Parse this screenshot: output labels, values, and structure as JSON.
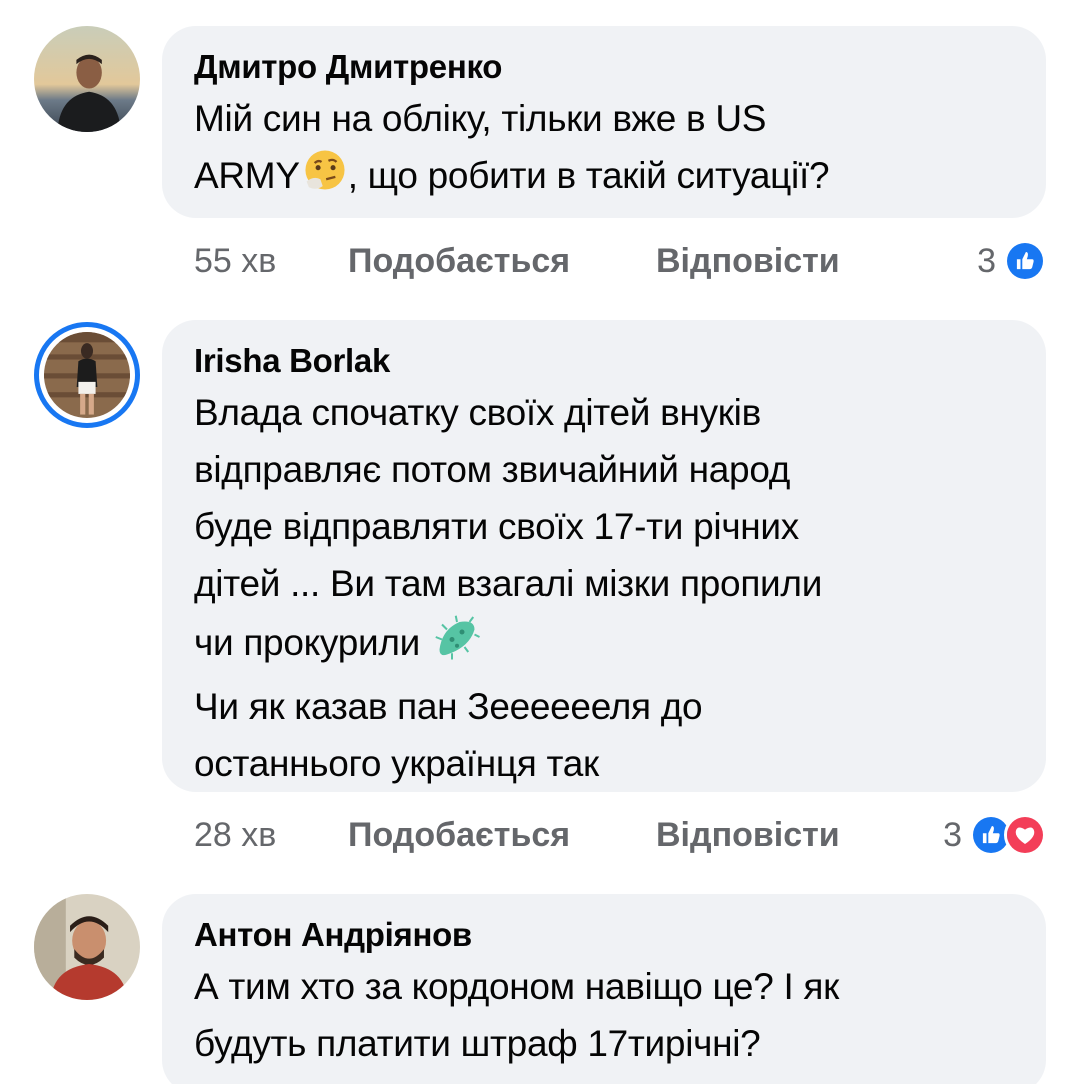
{
  "comments": [
    {
      "author": "Дмитро Дмитренко",
      "lines": [
        "Мій син на обліку, тільки вже в US",
        "ARMY",
        ", що робити в такій ситуації?"
      ],
      "time": "55 хв",
      "like_label": "Подобається",
      "reply_label": "Відповісти",
      "reaction_count": "3",
      "reactions": [
        "like-icon"
      ],
      "emoji": "thinking-face-icon"
    },
    {
      "author": "Irisha Borlak",
      "lines": [
        "Влада спочатку своїх дітей внуків",
        "відправляє потом звичайний народ",
        "буде відправляти своїх 17-ти річних",
        "дітей ... Ви там взагалі мізки пропили",
        "чи прокурили",
        "Чи як казав пан Зееееееля до",
        "останнього українця так"
      ],
      "time": "28 хв",
      "like_label": "Подобається",
      "reply_label": "Відповісти",
      "reaction_count": "3",
      "reactions": [
        "like-icon",
        "love-icon"
      ],
      "emoji": "microbe-icon"
    },
    {
      "author": "Антон Андріянов",
      "lines": [
        "А тим хто за кордоном навіщо це? І як",
        "будуть платити штраф 17тирічні?"
      ]
    }
  ],
  "colors": {
    "bubble": "#f0f2f5",
    "meta": "#65676b",
    "fb_blue": "#1877f2",
    "love_red": "#f33e58"
  }
}
